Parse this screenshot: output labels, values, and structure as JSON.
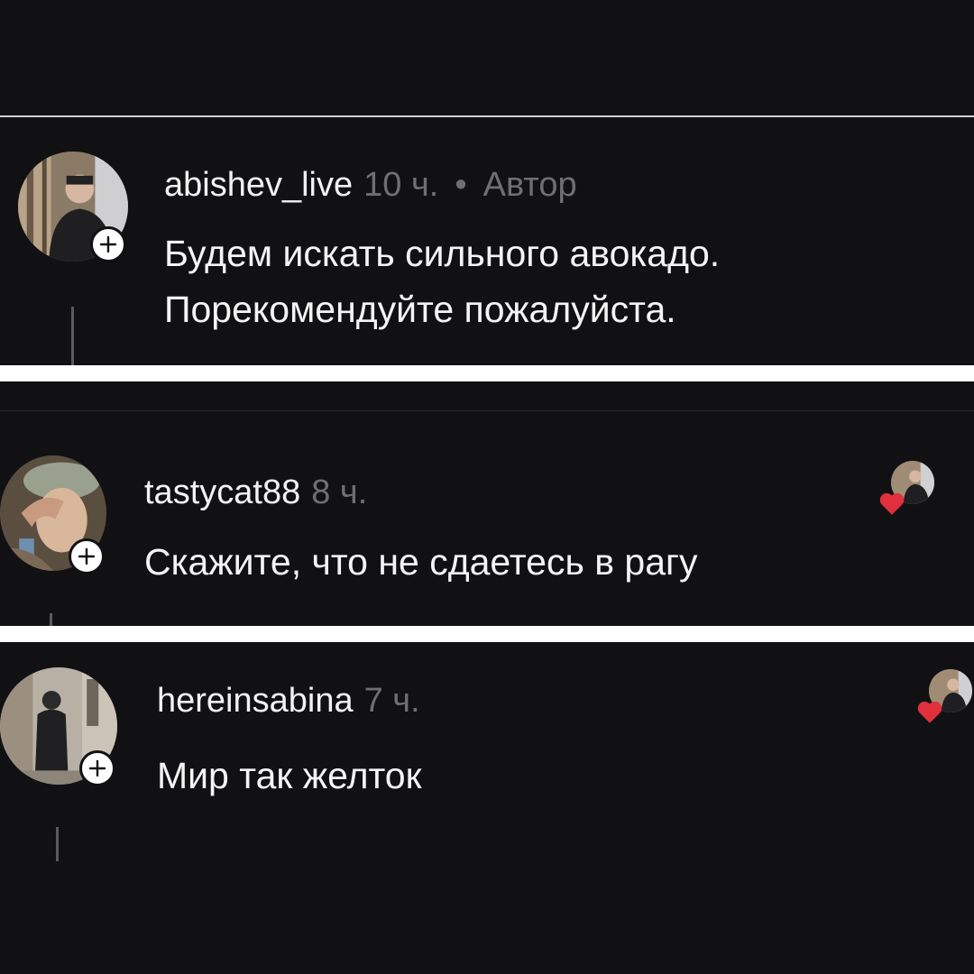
{
  "comments": [
    {
      "username": "abishev_live",
      "time": "10 ч.",
      "separator": "•",
      "author_badge": "Автор",
      "text_lines": [
        "Будем искать сильного авокадо.",
        "Порекомендуйте пожалуйста."
      ],
      "follow_icon": "plus-icon",
      "liked_by_author": false
    },
    {
      "username": "tastycat88",
      "time": "8 ч.",
      "text_lines": [
        "Скажите, что не сдаетесь в рагу"
      ],
      "follow_icon": "plus-icon",
      "liked_by_author": true
    },
    {
      "username": "hereinsabina",
      "time": "7 ч.",
      "text_lines": [
        "Мир так желток"
      ],
      "follow_icon": "plus-icon",
      "liked_by_author": true
    }
  ],
  "colors": {
    "background": "#111113",
    "frame": "#ffffff",
    "username": "#f2f2f2",
    "secondary_text": "#6f6f73",
    "heart": "#e0303c"
  }
}
